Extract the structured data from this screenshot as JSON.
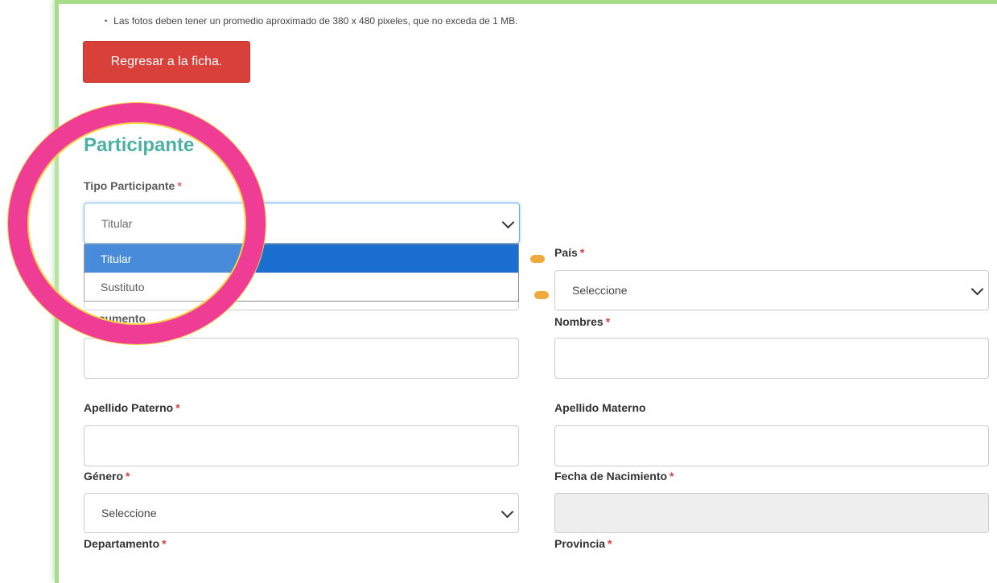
{
  "note": "Las fotos deben tener un promedio aproximado de 380 x 480 pixeles, que no exceda de 1 MB.",
  "back_button": "Regresar a la ficha.",
  "section_title": "Participante",
  "required_mark": "*",
  "fields": {
    "tipo_participante": {
      "label": "Tipo Participante",
      "value": "Titular",
      "options": [
        "Titular",
        "Sustituto"
      ],
      "selected": "Titular"
    },
    "pais": {
      "label": "País",
      "value": "Seleccione"
    },
    "documento": {
      "label": "Documento"
    },
    "nombres": {
      "label": "Nombres",
      "value": ""
    },
    "numero_documento": {
      "value": ""
    },
    "apellido_paterno": {
      "label": "Apellido Paterno",
      "value": ""
    },
    "apellido_materno": {
      "label": "Apellido Materno",
      "value": ""
    },
    "genero": {
      "label": "Género",
      "value": "Seleccione"
    },
    "fecha_nacimiento": {
      "label": "Fecha de Nacimiento",
      "value": ""
    },
    "departamento": {
      "label": "Departamento"
    },
    "provincia": {
      "label": "Provincia"
    }
  },
  "colors": {
    "accent": "#1e9e8c",
    "danger": "#d9403a",
    "highlight_ring": "#ef3d96",
    "frame_border": "#a6dc8c",
    "selected_option": "#1a6fd1",
    "marker": "#f0a93c"
  },
  "icons": [
    "chevron-down-icon"
  ]
}
